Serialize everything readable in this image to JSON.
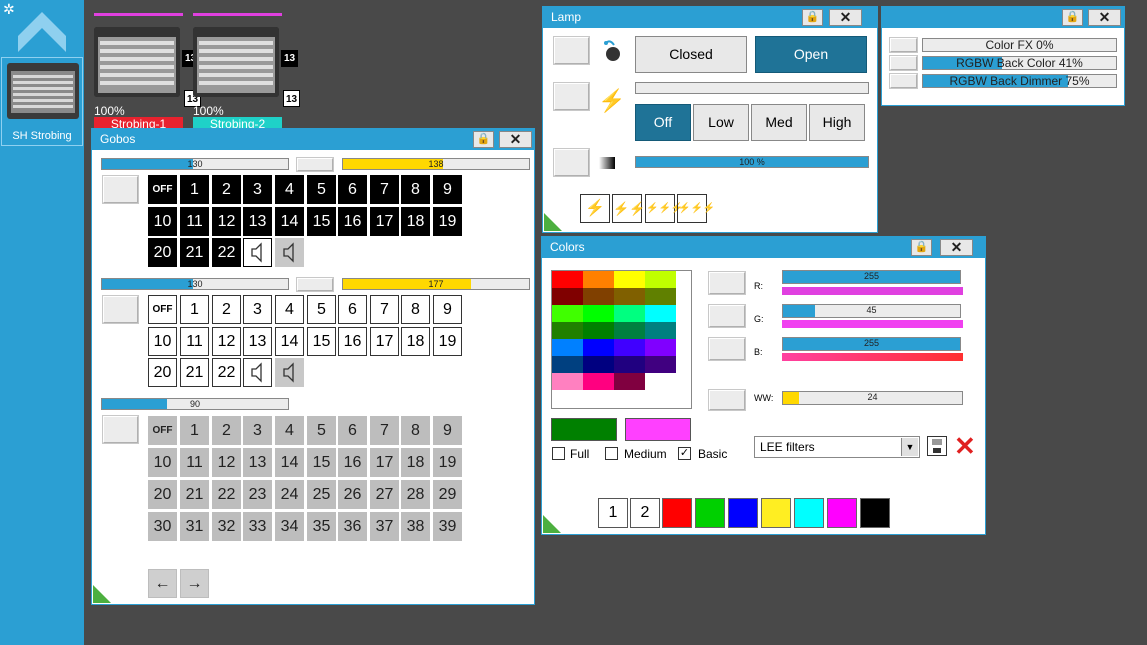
{
  "sidebar": {
    "gear_icon": "gear-icon",
    "up_icon": "chevron-up-icon",
    "tile_label": "SH Strobing"
  },
  "fixtures": [
    {
      "badge_top": "13",
      "badge_bottom": "13",
      "percent": "100%",
      "name": "Strobing-1",
      "color": "#e8222e"
    },
    {
      "badge_top": "13",
      "badge_bottom": "13",
      "percent": "100%",
      "name": "Strobing-2",
      "color": "#1fd1c8"
    }
  ],
  "gobos": {
    "title": "Gobos",
    "wheel1": {
      "bar_left": "130",
      "bar_left_fill": 0.49,
      "bar_right": "138",
      "bar_right_fill": 0.54
    },
    "wheel2": {
      "bar_left": "130",
      "bar_left_fill": 0.49,
      "bar_right": "177",
      "bar_right_fill": 0.69
    },
    "wheel3": {
      "bar": "90",
      "bar_fill": 0.35
    },
    "off_label": "OFF",
    "row_a": [
      "1",
      "2",
      "3",
      "4",
      "5",
      "6",
      "7",
      "8",
      "9"
    ],
    "row_b": [
      "10",
      "11",
      "12",
      "13",
      "14",
      "15",
      "16",
      "17",
      "18",
      "19"
    ],
    "row_c": [
      "20",
      "21",
      "22"
    ],
    "grid3": [
      [
        "1",
        "2",
        "3",
        "4",
        "5",
        "6",
        "7",
        "8",
        "9"
      ],
      [
        "10",
        "11",
        "12",
        "13",
        "14",
        "15",
        "16",
        "17",
        "18",
        "19"
      ],
      [
        "20",
        "21",
        "22",
        "23",
        "24",
        "25",
        "26",
        "27",
        "28",
        "29"
      ],
      [
        "30",
        "31",
        "32",
        "33",
        "34",
        "35",
        "36",
        "37",
        "38",
        "39"
      ]
    ],
    "prev_icon": "arrow-left-icon",
    "next_icon": "arrow-right-icon"
  },
  "lamp": {
    "title": "Lamp",
    "closed_label": "Closed",
    "open_label": "Open",
    "off_label": "Off",
    "low_label": "Low",
    "med_label": "Med",
    "high_label": "High",
    "dimmer_label": "100 %",
    "dimmer_fill": 1.0
  },
  "fx": {
    "items": [
      {
        "label": "Color FX",
        "value": "0%",
        "fill": 0.0
      },
      {
        "label": "RGBW Back Color",
        "value": "41%",
        "fill": 0.41
      },
      {
        "label": "RGBW Back Dimmer",
        "value": "75%",
        "fill": 0.75
      }
    ]
  },
  "colors": {
    "title": "Colors",
    "palette": [
      [
        "#ff0000",
        "#ff8000",
        "#ffff00",
        "#c0ff00"
      ],
      [
        "#800000",
        "#804000",
        "#806000",
        "#608000"
      ],
      [
        "#40ff00",
        "#00ff00",
        "#00ff80",
        "#00ffff"
      ],
      [
        "#208000",
        "#008000",
        "#008040",
        "#008080"
      ],
      [
        "#0080ff",
        "#0000ff",
        "#4000ff",
        "#8000ff"
      ],
      [
        "#004080",
        "#000080",
        "#200080",
        "#400080"
      ],
      [
        "#ff80c0",
        "#ff0080",
        "#800040",
        "#ffffff"
      ]
    ],
    "current_color": "#008000",
    "target_color": "#ff40ff",
    "r_label": "R:",
    "r_value": "255",
    "r_fill": 1.0,
    "g_label": "G:",
    "g_value": "45",
    "g_fill": 0.18,
    "b_label": "B:",
    "b_value": "255",
    "b_fill": 1.0,
    "ww_label": "WW:",
    "ww_value": "24",
    "ww_fill": 0.09,
    "full_label": "Full",
    "medium_label": "Medium",
    "basic_label": "Basic",
    "filter_select": "LEE filters",
    "preset_1": "1",
    "preset_2": "2",
    "presets": [
      "#ff0000",
      "#00d000",
      "#0000ff",
      "#ffee22",
      "#00ffff",
      "#ff00ff",
      "#000000"
    ]
  }
}
